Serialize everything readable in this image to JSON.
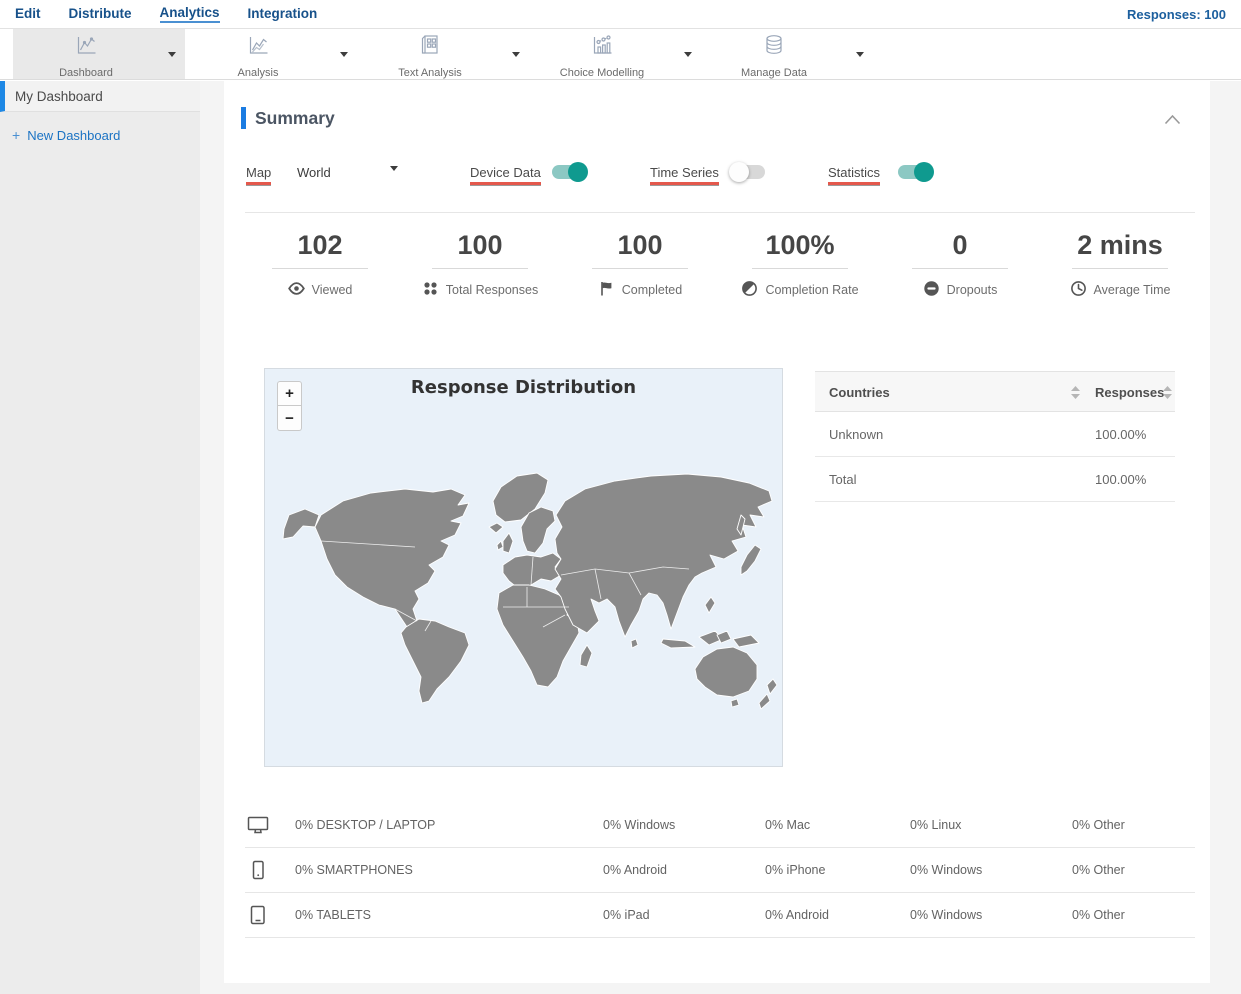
{
  "topnav": {
    "items": [
      {
        "label": "Edit",
        "active": false
      },
      {
        "label": "Distribute",
        "active": false
      },
      {
        "label": "Analytics",
        "active": true
      },
      {
        "label": "Integration",
        "active": false
      }
    ],
    "responses_label": "Responses: 100"
  },
  "toolbar": {
    "items": [
      {
        "label": "Dashboard",
        "icon": "line-chart-icon",
        "active": true
      },
      {
        "label": "Analysis",
        "icon": "multi-line-chart-icon",
        "active": false
      },
      {
        "label": "Text Analysis",
        "icon": "document-grid-icon",
        "active": false
      },
      {
        "label": "Choice Modelling",
        "icon": "scatter-bar-chart-icon",
        "active": false
      },
      {
        "label": "Manage Data",
        "icon": "database-icon",
        "active": false
      }
    ]
  },
  "sidebar": {
    "active_item": "My Dashboard",
    "new_dashboard": {
      "plus": "+",
      "label": "New Dashboard"
    }
  },
  "summary": {
    "title": "Summary",
    "controls": {
      "map_label": "Map",
      "map_value": "World",
      "toggles": [
        {
          "label": "Device Data",
          "on": true
        },
        {
          "label": "Time Series",
          "on": false
        },
        {
          "label": "Statistics",
          "on": true
        }
      ]
    },
    "stats": [
      {
        "value": "102",
        "label": "Viewed",
        "icon": "eye-icon"
      },
      {
        "value": "100",
        "label": "Total Responses",
        "icon": "dots-icon"
      },
      {
        "value": "100",
        "label": "Completed",
        "icon": "flag-icon"
      },
      {
        "value": "100%",
        "label": "Completion Rate",
        "icon": "half-circle-icon"
      },
      {
        "value": "0",
        "label": "Dropouts",
        "icon": "minus-circle-icon"
      },
      {
        "value": "2 mins",
        "label": "Average Time",
        "icon": "clock-icon"
      }
    ],
    "map": {
      "title": "Response Distribution",
      "zoom_in": "+",
      "zoom_out": "−"
    },
    "countries_table": {
      "columns": [
        "Countries",
        "Responses"
      ],
      "rows": [
        {
          "country": "Unknown",
          "responses": "100.00%"
        },
        {
          "country": "Total",
          "responses": "100.00%"
        }
      ]
    },
    "device_table": {
      "rows": [
        {
          "icon": "desktop-icon",
          "name": "0% DESKTOP / LAPTOP",
          "cells": [
            "0% Windows",
            "0% Mac",
            "0% Linux",
            "0% Other"
          ]
        },
        {
          "icon": "smartphone-icon",
          "name": "0% SMARTPHONES",
          "cells": [
            "0% Android",
            "0% iPhone",
            "0% Windows",
            "0% Other"
          ]
        },
        {
          "icon": "tablet-icon",
          "name": "0% TABLETS",
          "cells": [
            "0% iPad",
            "0% Android",
            "0% Windows",
            "0% Other"
          ]
        }
      ]
    }
  },
  "colors": {
    "nav_blue": "#17518a",
    "accent_blue": "#1b7ce2",
    "sidebar_active_blue": "#1e88e5",
    "underline_red": "#e4584c",
    "toggle_on_teal": "#0f9a8f",
    "map_background": "#e9f1f9",
    "map_land": "#8a8a8a"
  }
}
